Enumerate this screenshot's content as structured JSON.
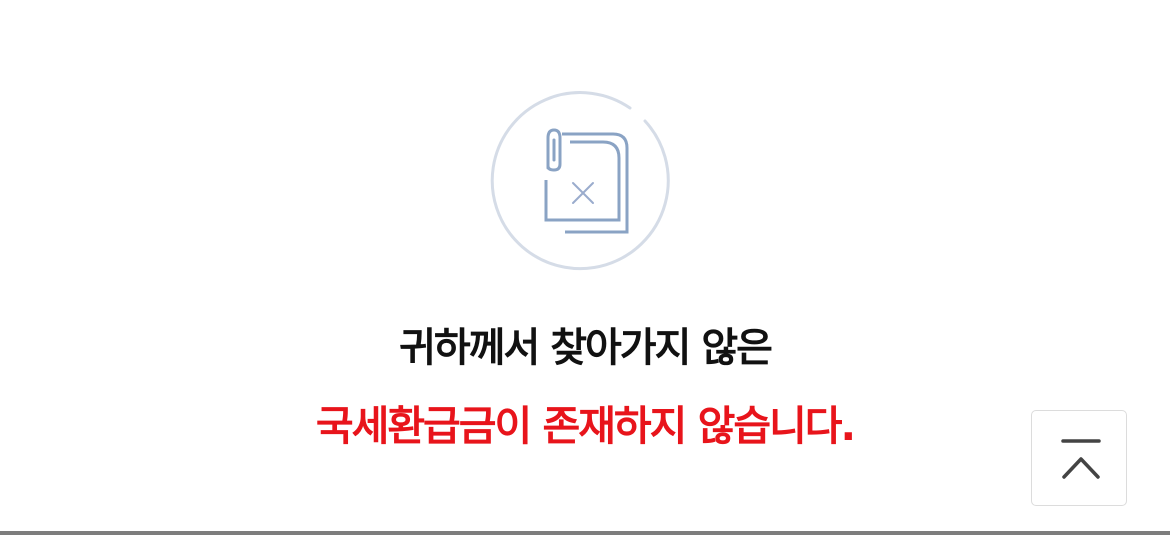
{
  "empty_state": {
    "icon": "document-not-found-icon",
    "message_line1": "귀하께서 찾아가지 않은",
    "message_line2": "국세환급금이 존재하지 않습니다.",
    "colors": {
      "line1": "#111111",
      "line2": "#e8141b",
      "icon_stroke": "#8aa3c4",
      "icon_circle": "#d5dce7"
    }
  },
  "scroll_top_button": {
    "icon": "chevron-up-to-top-icon"
  }
}
